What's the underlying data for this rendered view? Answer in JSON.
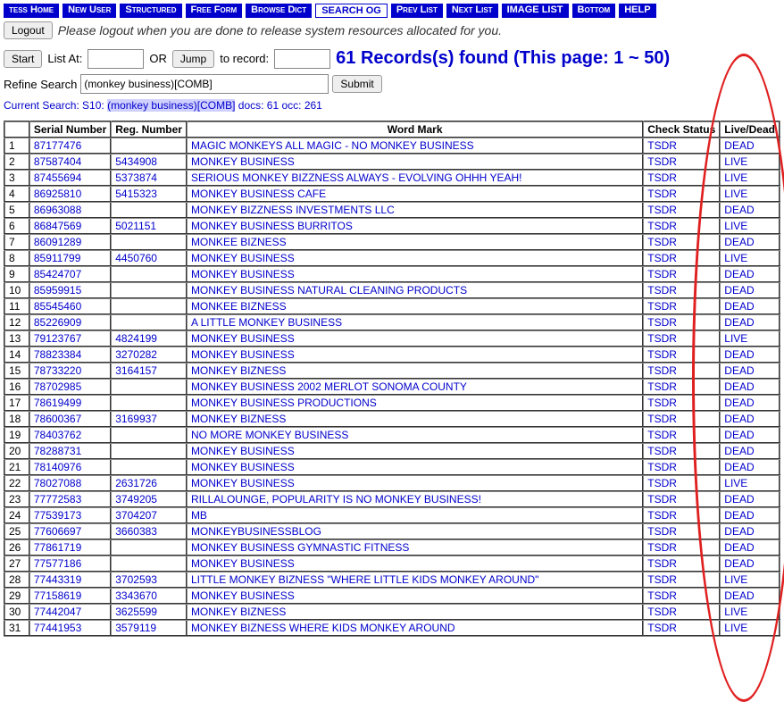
{
  "topnav": {
    "items": [
      {
        "label": "tess Home"
      },
      {
        "label": "New User"
      },
      {
        "label": "Structured"
      },
      {
        "label": "Free Form"
      },
      {
        "label": "Browse Dict"
      },
      {
        "label": "SEARCH OG"
      },
      {
        "label": "Prev List"
      },
      {
        "label": "Next List"
      },
      {
        "label": "IMAGE LIST"
      },
      {
        "label": "Bottom"
      },
      {
        "label": "HELP"
      }
    ]
  },
  "logout": {
    "button": "Logout",
    "message": "Please logout when you are done to release system resources allocated for you."
  },
  "nav": {
    "start": "Start",
    "list_at_label": "List At:",
    "list_at_value": "",
    "or_label": "OR",
    "jump": "Jump",
    "to_record_label": "to record:",
    "to_record_value": "",
    "records_found": "61 Records(s) found (This page: 1 ~ 50)"
  },
  "refine": {
    "label": "Refine Search",
    "value": "(monkey business)[COMB]",
    "submit": "Submit"
  },
  "current_search": {
    "label": "Current Search:",
    "sid": "S10:",
    "query": "(monkey business)[COMB]",
    "tail": " docs: 61 occ: 261"
  },
  "table": {
    "headers": {
      "blank": "",
      "serial": "Serial Number",
      "reg": "Reg. Number",
      "word": "Word Mark",
      "check": "Check Status",
      "live": "Live/Dead"
    },
    "rows": [
      {
        "n": 1,
        "serial": "87177476",
        "reg": "",
        "word": "MAGIC MONKEYS ALL MAGIC - NO MONKEY BUSINESS",
        "check": "TSDR",
        "live": "DEAD"
      },
      {
        "n": 2,
        "serial": "87587404",
        "reg": "5434908",
        "word": "MONKEY BUSINESS",
        "check": "TSDR",
        "live": "LIVE"
      },
      {
        "n": 3,
        "serial": "87455694",
        "reg": "5373874",
        "word": "SERIOUS MONKEY BIZZNESS ALWAYS - EVOLVING OHHH YEAH!",
        "check": "TSDR",
        "live": "LIVE"
      },
      {
        "n": 4,
        "serial": "86925810",
        "reg": "5415323",
        "word": "MONKEY BUSINESS CAFE",
        "check": "TSDR",
        "live": "LIVE"
      },
      {
        "n": 5,
        "serial": "86963088",
        "reg": "",
        "word": "MONKEY BIZZNESS INVESTMENTS LLC",
        "check": "TSDR",
        "live": "DEAD"
      },
      {
        "n": 6,
        "serial": "86847569",
        "reg": "5021151",
        "word": "MONKEY BUSINESS BURRITOS",
        "check": "TSDR",
        "live": "LIVE"
      },
      {
        "n": 7,
        "serial": "86091289",
        "reg": "",
        "word": "MONKEE BIZNESS",
        "check": "TSDR",
        "live": "DEAD"
      },
      {
        "n": 8,
        "serial": "85911799",
        "reg": "4450760",
        "word": "MONKEY BUSINESS",
        "check": "TSDR",
        "live": "LIVE"
      },
      {
        "n": 9,
        "serial": "85424707",
        "reg": "",
        "word": "MONKEY BUSINESS",
        "check": "TSDR",
        "live": "DEAD"
      },
      {
        "n": 10,
        "serial": "85959915",
        "reg": "",
        "word": "MONKEY BUSINESS NATURAL CLEANING PRODUCTS",
        "check": "TSDR",
        "live": "DEAD"
      },
      {
        "n": 11,
        "serial": "85545460",
        "reg": "",
        "word": "MONKEE BIZNESS",
        "check": "TSDR",
        "live": "DEAD"
      },
      {
        "n": 12,
        "serial": "85226909",
        "reg": "",
        "word": "A LITTLE MONKEY BUSINESS",
        "check": "TSDR",
        "live": "DEAD"
      },
      {
        "n": 13,
        "serial": "79123767",
        "reg": "4824199",
        "word": "MONKEY BUSINESS",
        "check": "TSDR",
        "live": "LIVE"
      },
      {
        "n": 14,
        "serial": "78823384",
        "reg": "3270282",
        "word": "MONKEY BUSINESS",
        "check": "TSDR",
        "live": "DEAD"
      },
      {
        "n": 15,
        "serial": "78733220",
        "reg": "3164157",
        "word": "MONKEY BIZNESS",
        "check": "TSDR",
        "live": "DEAD"
      },
      {
        "n": 16,
        "serial": "78702985",
        "reg": "",
        "word": "MONKEY BUSINESS 2002 MERLOT SONOMA COUNTY",
        "check": "TSDR",
        "live": "DEAD"
      },
      {
        "n": 17,
        "serial": "78619499",
        "reg": "",
        "word": "MONKEY BUSINESS PRODUCTIONS",
        "check": "TSDR",
        "live": "DEAD"
      },
      {
        "n": 18,
        "serial": "78600367",
        "reg": "3169937",
        "word": "MONKEY BIZNESS",
        "check": "TSDR",
        "live": "DEAD"
      },
      {
        "n": 19,
        "serial": "78403762",
        "reg": "",
        "word": "NO MORE MONKEY BUSINESS",
        "check": "TSDR",
        "live": "DEAD"
      },
      {
        "n": 20,
        "serial": "78288731",
        "reg": "",
        "word": "MONKEY BUSINESS",
        "check": "TSDR",
        "live": "DEAD"
      },
      {
        "n": 21,
        "serial": "78140976",
        "reg": "",
        "word": "MONKEY BUSINESS",
        "check": "TSDR",
        "live": "DEAD"
      },
      {
        "n": 22,
        "serial": "78027088",
        "reg": "2631726",
        "word": "MONKEY BUSINESS",
        "check": "TSDR",
        "live": "LIVE"
      },
      {
        "n": 23,
        "serial": "77772583",
        "reg": "3749205",
        "word": "RILLALOUNGE, POPULARITY IS NO MONKEY BUSINESS!",
        "check": "TSDR",
        "live": "DEAD"
      },
      {
        "n": 24,
        "serial": "77539173",
        "reg": "3704207",
        "word": "MB",
        "check": "TSDR",
        "live": "DEAD"
      },
      {
        "n": 25,
        "serial": "77606697",
        "reg": "3660383",
        "word": "MONKEYBUSINESSBLOG",
        "check": "TSDR",
        "live": "DEAD"
      },
      {
        "n": 26,
        "serial": "77861719",
        "reg": "",
        "word": "MONKEY BUSINESS GYMNASTIC FITNESS",
        "check": "TSDR",
        "live": "DEAD"
      },
      {
        "n": 27,
        "serial": "77577186",
        "reg": "",
        "word": "MONKEY BUSINESS",
        "check": "TSDR",
        "live": "DEAD"
      },
      {
        "n": 28,
        "serial": "77443319",
        "reg": "3702593",
        "word": "LITTLE MONKEY BIZNESS \"WHERE LITTLE KIDS MONKEY AROUND\"",
        "check": "TSDR",
        "live": "LIVE"
      },
      {
        "n": 29,
        "serial": "77158619",
        "reg": "3343670",
        "word": "MONKEY BUSINESS",
        "check": "TSDR",
        "live": "DEAD"
      },
      {
        "n": 30,
        "serial": "77442047",
        "reg": "3625599",
        "word": "MONKEY BIZNESS",
        "check": "TSDR",
        "live": "LIVE"
      },
      {
        "n": 31,
        "serial": "77441953",
        "reg": "3579119",
        "word": "MONKEY BIZNESS WHERE KIDS MONKEY AROUND",
        "check": "TSDR",
        "live": "LIVE"
      }
    ]
  }
}
